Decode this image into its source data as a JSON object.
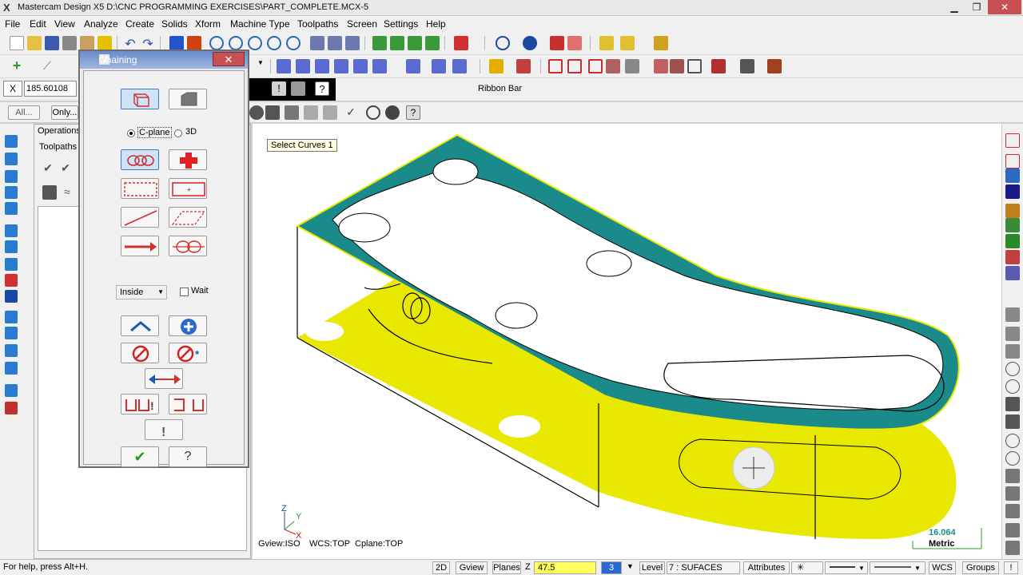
{
  "window": {
    "title": "Mastercam Design X5  D:\\CNC PROGRAMMING EXERCISES\\PART_COMPLETE.MCX-5",
    "logo": "X",
    "controls": [
      "▁",
      "❐",
      "✕"
    ]
  },
  "menu": [
    "File",
    "Edit",
    "View",
    "Analyze",
    "Create",
    "Solids",
    "Xform",
    "Machine Type",
    "Toolpaths",
    "Screen",
    "Settings",
    "Help"
  ],
  "ribbon": {
    "coord_label": "X",
    "coord_value": "185.60108",
    "label": "Ribbon Bar"
  },
  "filters": {
    "all": "All...",
    "only": "Only..."
  },
  "ops_manager": {
    "tabs": [
      "Operations",
      "Toolpaths"
    ]
  },
  "chaining": {
    "title": "Chaining",
    "close": "✕",
    "mode_cplane": "C-plane",
    "mode_3d": "3D",
    "mode_selected": "cplane",
    "inside_option": "Inside",
    "wait_label": "Wait",
    "wait_checked": false,
    "buttons": {
      "wireframe": "wireframe-chain-mode",
      "solids": "solids-chain-mode",
      "chain": "chain",
      "single_point": "single-point",
      "window": "window",
      "area": "area",
      "single": "single",
      "polygon": "polygon",
      "vector": "vector",
      "partial": "partial",
      "end": "end",
      "add": "add",
      "unselect": "unselect",
      "unselect_all": "unselect-all",
      "reverse": "reverse",
      "options_left": "chain-options",
      "options_right": "chain-filter",
      "info": "info",
      "ok": "✔",
      "help": "?"
    }
  },
  "viewport": {
    "prompt": "Select Curves 1",
    "gview": "Gview:ISO",
    "wcs": "WCS:TOP",
    "cplane": "Cplane:TOP",
    "scale_value": "16.064",
    "scale_unit": "Metric",
    "axis_z": "Z",
    "axis_y": "Y",
    "axis_x": "X",
    "colors": {
      "face": "#e8e800",
      "selected": "#1a8a8a",
      "line": "#000000"
    }
  },
  "status": {
    "help": "For help, press Alt+H.",
    "mode_2d": "2D",
    "gview": "Gview",
    "planes": "Planes",
    "z_label": "Z",
    "z_value": "47.5",
    "color_value": "3",
    "level_label": "Level",
    "level_value": "7 : SUFACES",
    "attributes": "Attributes",
    "point_style": "✳",
    "wcs": "WCS",
    "groups": "Groups",
    "bang": "!"
  }
}
